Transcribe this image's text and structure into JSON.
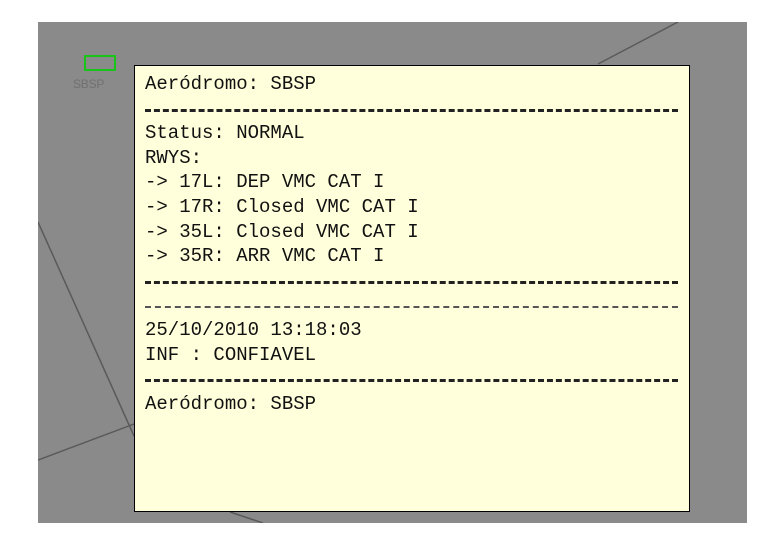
{
  "colors": {
    "map_background": "#8a8a8a",
    "panel_background": "#ffffdb",
    "aerodrome_symbol": "#19c419",
    "map_lines": "#5a5a5a"
  },
  "map": {
    "aerodrome_code": "SBSP",
    "aerodrome_symbol_icon": "aerodrome-square-icon"
  },
  "panel": {
    "header": "Aeródromo: SBSP",
    "status": "Status: NORMAL",
    "rwys_label": "RWYS:",
    "runways": [
      "-> 17L: DEP VMC CAT I",
      "-> 17R: Closed VMC CAT I",
      "-> 35L: Closed VMC CAT I",
      "-> 35R: ARR VMC CAT I"
    ],
    "datetime": "25/10/2010 13:18:03",
    "inf": "INF : CONFIAVEL",
    "footer": "Aeródromo: SBSP"
  }
}
